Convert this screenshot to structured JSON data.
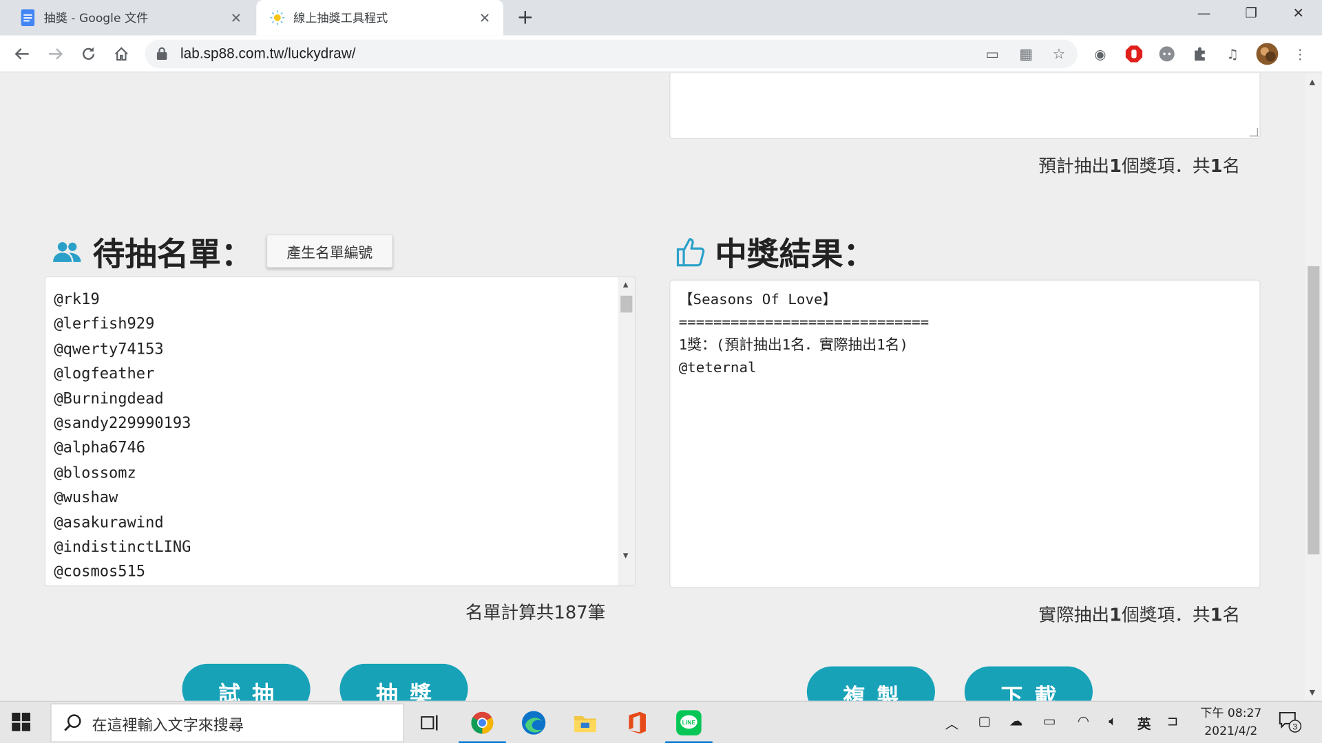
{
  "browser": {
    "tabs": [
      {
        "title": "抽獎 - Google 文件",
        "active": false,
        "icon": "google-docs-icon"
      },
      {
        "title": "線上抽獎工具程式",
        "active": true,
        "icon": "sun-favicon-icon"
      }
    ],
    "new_tab": "+",
    "url": "lab.sp88.com.tw/luckydraw/"
  },
  "page": {
    "estimate_prefix": "預計抽出",
    "estimate_prizes": "1",
    "estimate_mid": "個獎項．共",
    "estimate_people": "1",
    "estimate_suffix": "名",
    "list_title": "待抽名單：",
    "gen_button": "產生名單編號",
    "result_title": "中獎結果：",
    "list_items": [
      "@rk19",
      "@lerfish929",
      "@qwerty74153",
      "@logfeather",
      "@Burningdead",
      "@sandy229990193",
      "@alpha6746",
      "@blossomz",
      "@wushaw",
      "@asakurawind",
      "@indistinctLING",
      "@cosmos515"
    ],
    "count_prefix": "名單計算共",
    "count_value": "187",
    "count_suffix": "筆",
    "result_lines": [
      "【Seasons Of Love】",
      "=============================",
      "1獎：(預計抽出1名．實際抽出1名)",
      "@teternal"
    ],
    "actual_prefix": "實際抽出",
    "actual_prizes": "1",
    "actual_mid": "個獎項．共",
    "actual_people": "1",
    "actual_suffix": "名",
    "buttons": {
      "trial": "試抽",
      "draw": "抽獎",
      "copy": "複製",
      "download": "下載"
    }
  },
  "taskbar": {
    "search_placeholder": "在這裡輸入文字來搜尋",
    "ime": "英",
    "time": "下午 08:27",
    "date": "2021/4/2",
    "notifications": "3"
  },
  "colors": {
    "accent": "#17a2b8",
    "icon_blue": "#2aa0c9"
  }
}
